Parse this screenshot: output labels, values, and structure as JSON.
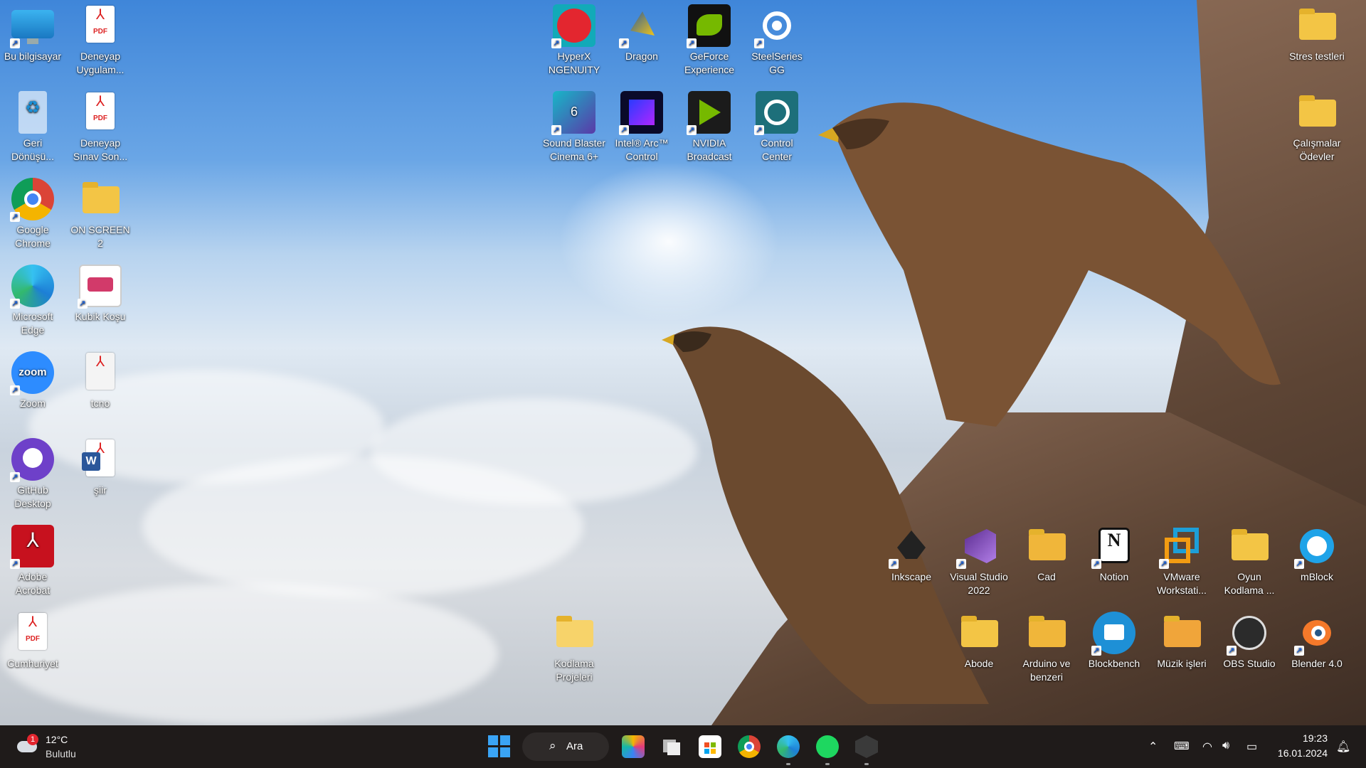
{
  "desktop_icons": [
    {
      "label": "Bu bilgisayar",
      "icon": "monitor-icon"
    },
    {
      "label": "Deneyap Uygulam...",
      "icon": "pdf-icon"
    },
    {
      "label": "Geri Dönüşü...",
      "icon": "recycle-bin-icon"
    },
    {
      "label": "Deneyap Sınav Son...",
      "icon": "pdf-icon"
    },
    {
      "label": "Google Chrome",
      "icon": "chrome-icon"
    },
    {
      "label": "ON SCREEN 2",
      "icon": "folder-icon"
    },
    {
      "label": "Microsoft Edge",
      "icon": "edge-icon"
    },
    {
      "label": "Kubik Koşu",
      "icon": "app-icon"
    },
    {
      "label": "Zoom",
      "icon": "zoom-icon"
    },
    {
      "label": "tcno",
      "icon": "text-file-icon"
    },
    {
      "label": "GitHub Desktop",
      "icon": "github-icon"
    },
    {
      "label": "şiir",
      "icon": "word-icon"
    },
    {
      "label": "Adobe Acrobat",
      "icon": "acrobat-icon"
    },
    {
      "label": "Cumhuriyet",
      "icon": "pdf-icon"
    },
    {
      "label": "HyperX NGENUITY",
      "icon": "hyperx-icon"
    },
    {
      "label": "Dragon",
      "icon": "dragon-icon"
    },
    {
      "label": "GeForce Experience",
      "icon": "nvidia-icon"
    },
    {
      "label": "SteelSeries GG",
      "icon": "steelseries-icon"
    },
    {
      "label": "Sound Blaster Cinema 6+",
      "icon": "sound-blaster-icon"
    },
    {
      "label": "Intel® Arc™ Control",
      "icon": "intel-arc-icon"
    },
    {
      "label": "NVIDIA Broadcast",
      "icon": "nvidia-broadcast-icon"
    },
    {
      "label": "Control Center",
      "icon": "control-center-icon"
    },
    {
      "label": "Stres testleri",
      "icon": "folder-icon"
    },
    {
      "label": "Çalışmalar Ödevler",
      "icon": "folder-icon"
    },
    {
      "label": "Inkscape",
      "icon": "inkscape-icon"
    },
    {
      "label": "Visual Studio 2022",
      "icon": "visual-studio-icon"
    },
    {
      "label": "Cad",
      "icon": "folder-icon"
    },
    {
      "label": "Notion",
      "icon": "notion-icon"
    },
    {
      "label": "VMware Workstati...",
      "icon": "vmware-icon"
    },
    {
      "label": "Oyun Kodlama ...",
      "icon": "folder-icon"
    },
    {
      "label": "mBlock",
      "icon": "mblock-icon"
    },
    {
      "label": "Kodlama Projeleri",
      "icon": "folder-icon"
    },
    {
      "label": "Abode",
      "icon": "folder-icon"
    },
    {
      "label": "Arduino ve benzeri",
      "icon": "folder-icon"
    },
    {
      "label": "Blockbench",
      "icon": "blockbench-icon"
    },
    {
      "label": "Müzik işleri",
      "icon": "folder-icon"
    },
    {
      "label": "OBS Studio",
      "icon": "obs-icon"
    },
    {
      "label": "Blender 4.0",
      "icon": "blender-icon"
    }
  ],
  "taskbar": {
    "weather": {
      "temp": "12°C",
      "condition": "Bulutlu",
      "badge": "1"
    },
    "search_label": "Ara",
    "pinned_apps": [
      "start-icon",
      "search",
      "copilot-icon",
      "task-view-icon",
      "store-icon",
      "chrome-icon",
      "edge-icon",
      "spotify-icon",
      "app-icon"
    ],
    "clock": {
      "time": "19:23",
      "date": "16.01.2024"
    }
  },
  "colors": {
    "taskbar_bg": "#1f1b1a",
    "folder": "#f3c545",
    "accent": "#0078d4"
  }
}
